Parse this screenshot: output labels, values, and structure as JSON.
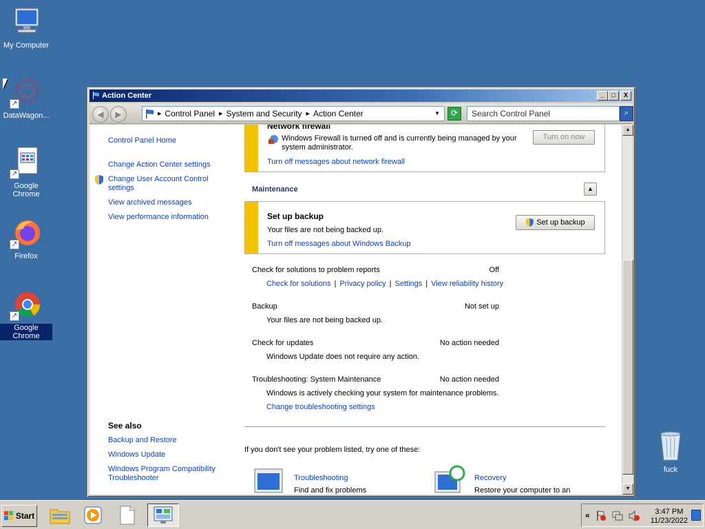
{
  "desktop": {
    "icons": [
      {
        "label": "My Computer",
        "icon": "computer-icon"
      },
      {
        "label": "DataWagon...",
        "icon": "datawagon-icon"
      },
      {
        "label": "Google Chrome",
        "icon": "document-app-icon"
      },
      {
        "label": "Firefox",
        "icon": "firefox-icon"
      },
      {
        "label": "Google Chrome",
        "icon": "chrome-icon"
      },
      {
        "label": "fuck",
        "icon": "recycle-bin-icon"
      }
    ]
  },
  "window": {
    "title": "Action Center",
    "breadcrumb": [
      "Control Panel",
      "System and Security",
      "Action Center"
    ],
    "search_placeholder": "Search Control Panel",
    "left_nav": {
      "home": "Control Panel Home",
      "links": [
        "Change Action Center settings",
        "Change User Account Control settings",
        "View archived messages",
        "View performance information"
      ],
      "see_also_title": "See also",
      "see_also": [
        "Backup and Restore",
        "Windows Update",
        "Windows Program Compatibility Troubleshooter"
      ]
    },
    "firewall": {
      "title": "Network firewall",
      "message": "Windows Firewall is turned off and is currently being managed by your system administrator.",
      "button": "Turn on now",
      "link": "Turn off messages about network firewall"
    },
    "maintenance": {
      "title": "Maintenance",
      "backup_alert": {
        "title": "Set up backup",
        "message": "Your files are not being backed up.",
        "button": "Set up backup",
        "link": "Turn off messages about Windows Backup"
      },
      "items": [
        {
          "label": "Check for solutions to problem reports",
          "status": "Off",
          "links": [
            "Check for solutions",
            "Privacy policy",
            "Settings",
            "View reliability history"
          ]
        },
        {
          "label": "Backup",
          "status": "Not set up",
          "detail": "Your files are not being backed up."
        },
        {
          "label": "Check for updates",
          "status": "No action needed",
          "detail": "Windows Update does not require any action."
        },
        {
          "label": "Troubleshooting: System Maintenance",
          "status": "No action needed",
          "detail": "Windows is actively checking your system for maintenance problems.",
          "link": "Change troubleshooting settings"
        }
      ]
    },
    "footer": {
      "prompt": "If you don't see your problem listed, try one of these:",
      "troubleshooting": {
        "title": "Troubleshooting",
        "desc": "Find and fix problems"
      },
      "recovery": {
        "title": "Recovery",
        "desc": "Restore your computer to an"
      }
    },
    "controls": {
      "minimize": "_",
      "maximize": "□",
      "close": "X"
    }
  },
  "taskbar": {
    "start_label": "Start",
    "clock_time": "3:47 PM",
    "clock_date": "11/23/2022",
    "tray_expand": "«"
  },
  "colors": {
    "desktop": "#3a6ea5",
    "alert_bar": "#f4c300",
    "link": "#0c42ae",
    "titlebar_start": "#0a246a"
  }
}
